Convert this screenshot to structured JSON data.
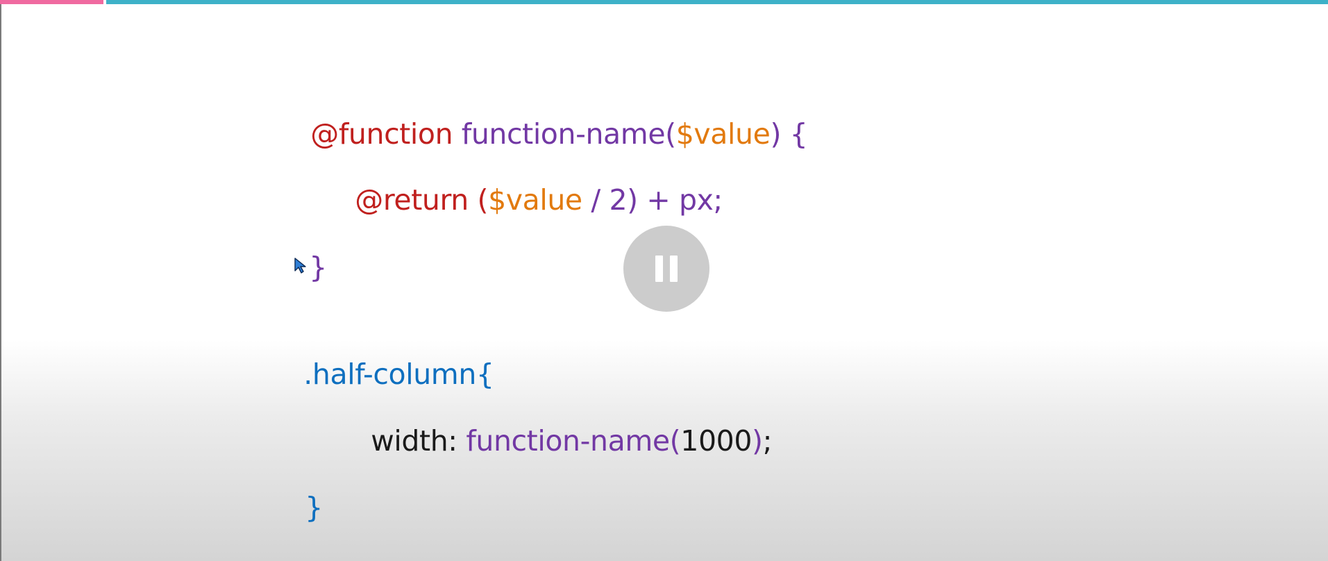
{
  "player": {
    "progress_fraction": 0.078,
    "played_color": "#f06aa0",
    "track_color": "#3db1c8",
    "pause_button": {
      "icon": "pause-icon"
    }
  },
  "colors": {
    "at_rule": "#c0201e",
    "function": "#7238a4",
    "variable": "#e27a0e",
    "selector": "#0e6fbf",
    "plain": "#1a1a1a"
  },
  "code": {
    "line1": {
      "at_function": "@function",
      "fn_name": "function-name(",
      "param": "$value",
      "close": ") {"
    },
    "line2": {
      "at_return": "@return",
      "open_paren": "(",
      "param": "$value",
      "rest": " / 2) + px;"
    },
    "line3": {
      "brace": "}"
    },
    "line4": {
      "selector": ".half-column{"
    },
    "line5": {
      "property": "width: ",
      "fn_call": "function-name(",
      "arg": "1000",
      "close_paren": ")",
      "semicolon": ";"
    },
    "line6": {
      "brace": "}"
    }
  }
}
